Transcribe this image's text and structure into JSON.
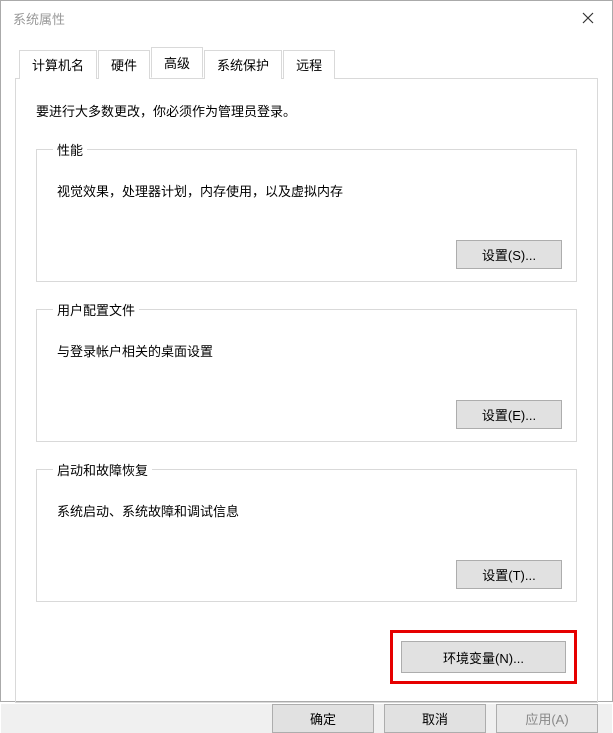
{
  "window": {
    "title": "系统属性"
  },
  "tabs": {
    "t0": "计算机名",
    "t1": "硬件",
    "t2": "高级",
    "t3": "系统保护",
    "t4": "远程"
  },
  "panel": {
    "intro": "要进行大多数更改，你必须作为管理员登录。",
    "group1": {
      "title": "性能",
      "desc": "视觉效果，处理器计划，内存使用，以及虚拟内存",
      "button": "设置(S)..."
    },
    "group2": {
      "title": "用户配置文件",
      "desc": "与登录帐户相关的桌面设置",
      "button": "设置(E)..."
    },
    "group3": {
      "title": "启动和故障恢复",
      "desc": "系统启动、系统故障和调试信息",
      "button": "设置(T)..."
    },
    "env_button": "环境变量(N)..."
  },
  "footer": {
    "ok": "确定",
    "cancel": "取消",
    "apply": "应用(A)"
  }
}
